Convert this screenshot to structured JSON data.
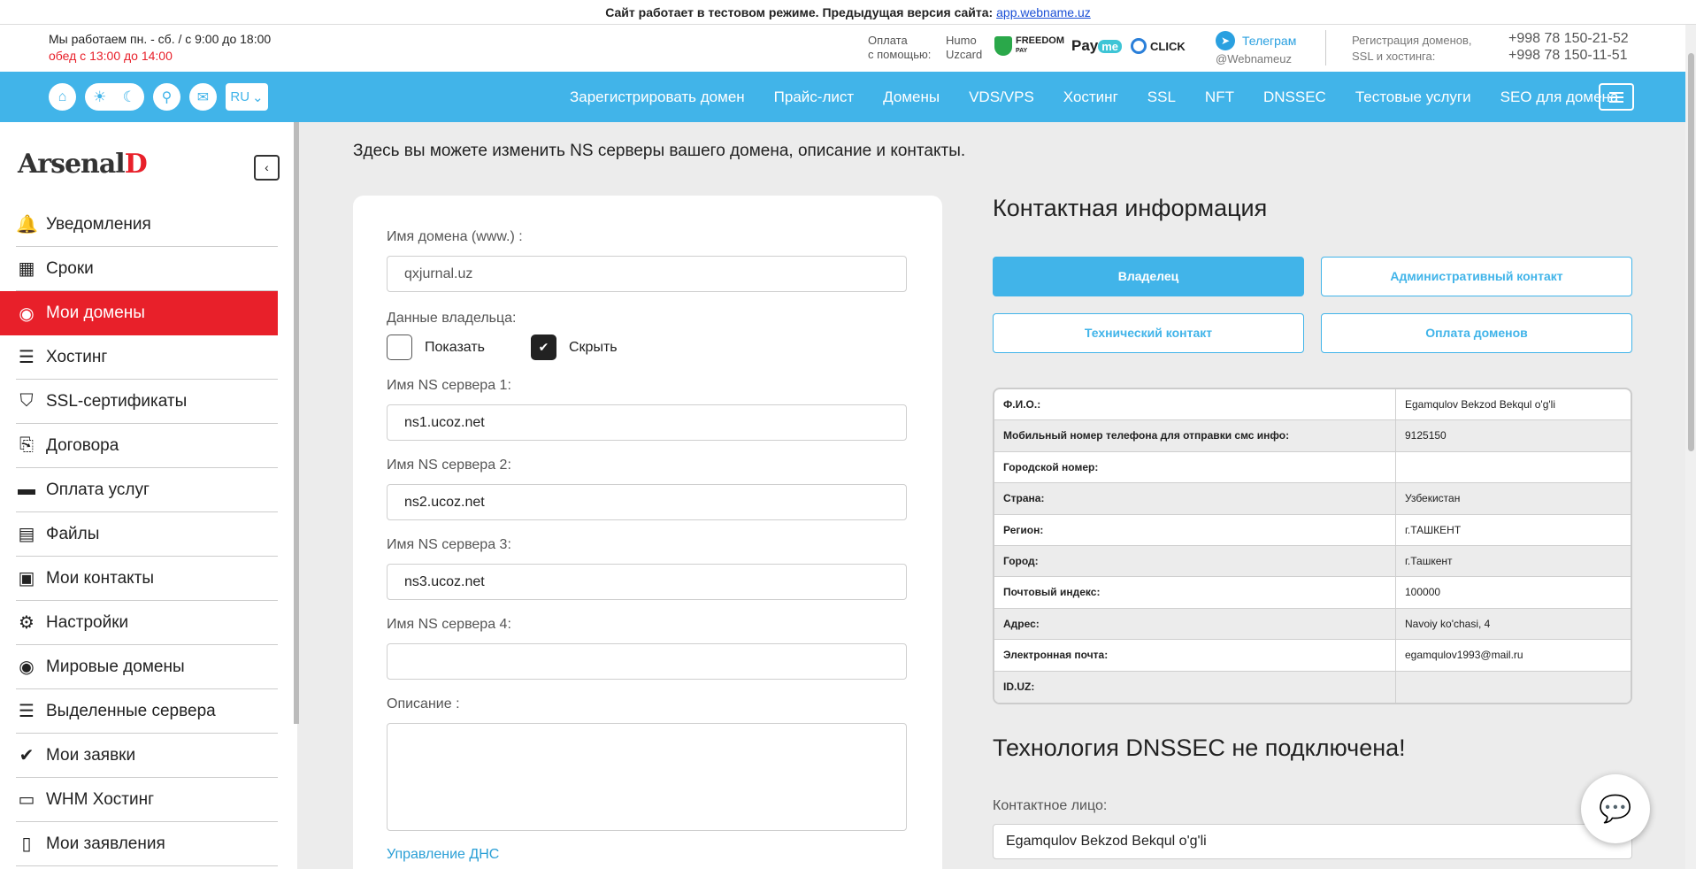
{
  "notice": {
    "text": "Сайт работает в тестовом режиме. Предыдущая версия сайта:",
    "link": "app.webname.uz"
  },
  "hours": {
    "line1": "Мы работаем пн. - сб. / с 9:00 до 18:00",
    "line2": "обед с 13:00 до 14:00"
  },
  "payment": {
    "label1": "Оплата",
    "label2": "с помощью:",
    "humo": "Humo",
    "uzcard": "Uzcard",
    "freedom": "FREEDOM",
    "freedom_sub": "PAY",
    "payme_a": "Pay",
    "payme_b": "me",
    "click": "CLICK"
  },
  "telegram": {
    "title": "Телеграм",
    "handle": "@Webnameuz"
  },
  "registration": {
    "line1": "Регистрация доменов,",
    "line2": "SSL и хостинга:",
    "phone1": "+998 78 150-21-52",
    "phone2": "+998 78 150-11-51"
  },
  "nav": {
    "lang": "RU",
    "links": [
      "Зарегистрировать домен",
      "Прайс-лист",
      "Домены",
      "VDS/VPS",
      "Хостинг",
      "SSL",
      "NFT",
      "DNSSEC",
      "Тестовые услуги",
      "SEO для домена"
    ]
  },
  "sidebar": {
    "brand": "Arsenal",
    "brand_mark": "D",
    "items": [
      {
        "label": "Уведомления",
        "icon": "bell-icon"
      },
      {
        "label": "Сроки",
        "icon": "calendar-icon"
      },
      {
        "label": "Мои домены",
        "icon": "globe-icon"
      },
      {
        "label": "Хостинг",
        "icon": "server-icon"
      },
      {
        "label": "SSL-сертификаты",
        "icon": "shield-icon"
      },
      {
        "label": "Договора",
        "icon": "documents-icon"
      },
      {
        "label": "Оплата услуг",
        "icon": "credit-card-icon"
      },
      {
        "label": "Файлы",
        "icon": "file-icon"
      },
      {
        "label": "Мои контакты",
        "icon": "contact-icon"
      },
      {
        "label": "Настройки",
        "icon": "gear-icon"
      },
      {
        "label": "Мировые домены",
        "icon": "globe-icon"
      },
      {
        "label": "Выделенные сервера",
        "icon": "server-icon"
      },
      {
        "label": "Мои заявки",
        "icon": "check-circle-icon"
      },
      {
        "label": "WHM Хостинг",
        "icon": "id-card-icon"
      },
      {
        "label": "Мои заявления",
        "icon": "document-icon"
      }
    ]
  },
  "main": {
    "intro": "Здесь вы можете изменить NS серверы вашего домена, описание и контакты.",
    "domain_label": "Имя домена (www.) :",
    "domain_value": "qxjurnal.uz",
    "owner_label": "Данные владельца:",
    "show_label": "Показать",
    "hide_label": "Скрыть",
    "ns1_label": "Имя NS сервера 1:",
    "ns1_value": "ns1.ucoz.net",
    "ns2_label": "Имя NS сервера 2:",
    "ns2_value": "ns2.ucoz.net",
    "ns3_label": "Имя NS сервера 3:",
    "ns3_value": "ns3.ucoz.net",
    "ns4_label": "Имя NS сервера 4:",
    "ns4_value": "",
    "desc_label": "Описание :",
    "dns_link": "Управление ДНС"
  },
  "contact": {
    "title": "Контактная информация",
    "tabs": [
      "Владелец",
      "Административный контакт",
      "Технический контакт",
      "Оплата доменов"
    ],
    "rows": [
      {
        "k": "Ф.И.О.:",
        "v": "Egamqulov Bekzod Bekqul o'g'li"
      },
      {
        "k": "Мобильный номер телефона для отправки смс инфо:",
        "v": "9125150"
      },
      {
        "k": "Городской номер:",
        "v": ""
      },
      {
        "k": "Страна:",
        "v": "Узбекистан"
      },
      {
        "k": "Регион:",
        "v": "г.ТАШКЕНТ"
      },
      {
        "k": "Город:",
        "v": "г.Ташкент"
      },
      {
        "k": "Почтовый индекс:",
        "v": "100000"
      },
      {
        "k": "Адрес:",
        "v": "Navoiy ko'chasi, 4"
      },
      {
        "k": "Электронная почта:",
        "v": "egamqulov1993@mail.ru"
      },
      {
        "k": "ID.UZ:",
        "v": ""
      }
    ],
    "dnssec_title": "Технология DNSSEC не подключена!",
    "contact_person_label": "Контактное лицо:",
    "contact_person_value": "Egamqulov Bekzod Bekqul o'g'li"
  }
}
